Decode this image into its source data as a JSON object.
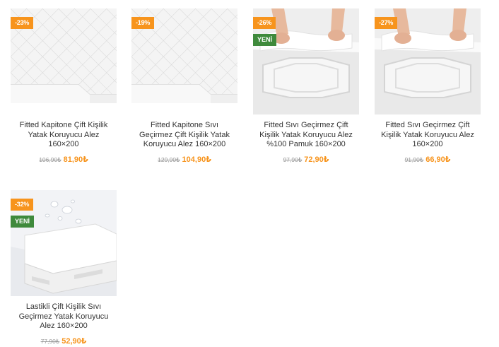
{
  "products": [
    {
      "title": "Fitted Kapitone Çift Kişilik Yatak Koruyucu Alez 160×200",
      "discount": "-23%",
      "new_label": "",
      "old_price": "106,90₺",
      "price": "81,90₺",
      "image": "quilted-mattress-protector"
    },
    {
      "title": "Fitted Kapitone Sıvı Geçirmez Çift Kişilik Yatak Koruyucu Alez 160×200",
      "discount": "-19%",
      "new_label": "",
      "old_price": "129,90₺",
      "price": "104,90₺",
      "image": "quilted-mattress-protector"
    },
    {
      "title": "Fitted Sıvı Geçirmez Çift Kişilik Yatak Koruyucu Alez %100 Pamuk 160×200",
      "discount": "-26%",
      "new_label": "YENİ",
      "old_price": "97,90₺",
      "price": "72,90₺",
      "image": "hands-fitting-sheet-on-mattress"
    },
    {
      "title": "Fitted Sıvı Geçirmez Çift Kişilik Yatak Koruyucu Alez 160×200",
      "discount": "-27%",
      "new_label": "",
      "old_price": "91,90₺",
      "price": "66,90₺",
      "image": "hands-fitting-sheet-on-mattress"
    },
    {
      "title": "Lastikli Çift Kişilik Sıvı Geçirmez Yatak Koruyucu Alez 160×200",
      "discount": "-32%",
      "new_label": "YENİ",
      "old_price": "77,90₺",
      "price": "52,90₺",
      "image": "waterproof-sheet-with-droplets"
    }
  ],
  "colors": {
    "discount_badge": "#f7941d",
    "new_badge": "#3f8a3c",
    "price": "#f7941d",
    "old_price": "#9a9a9a"
  }
}
